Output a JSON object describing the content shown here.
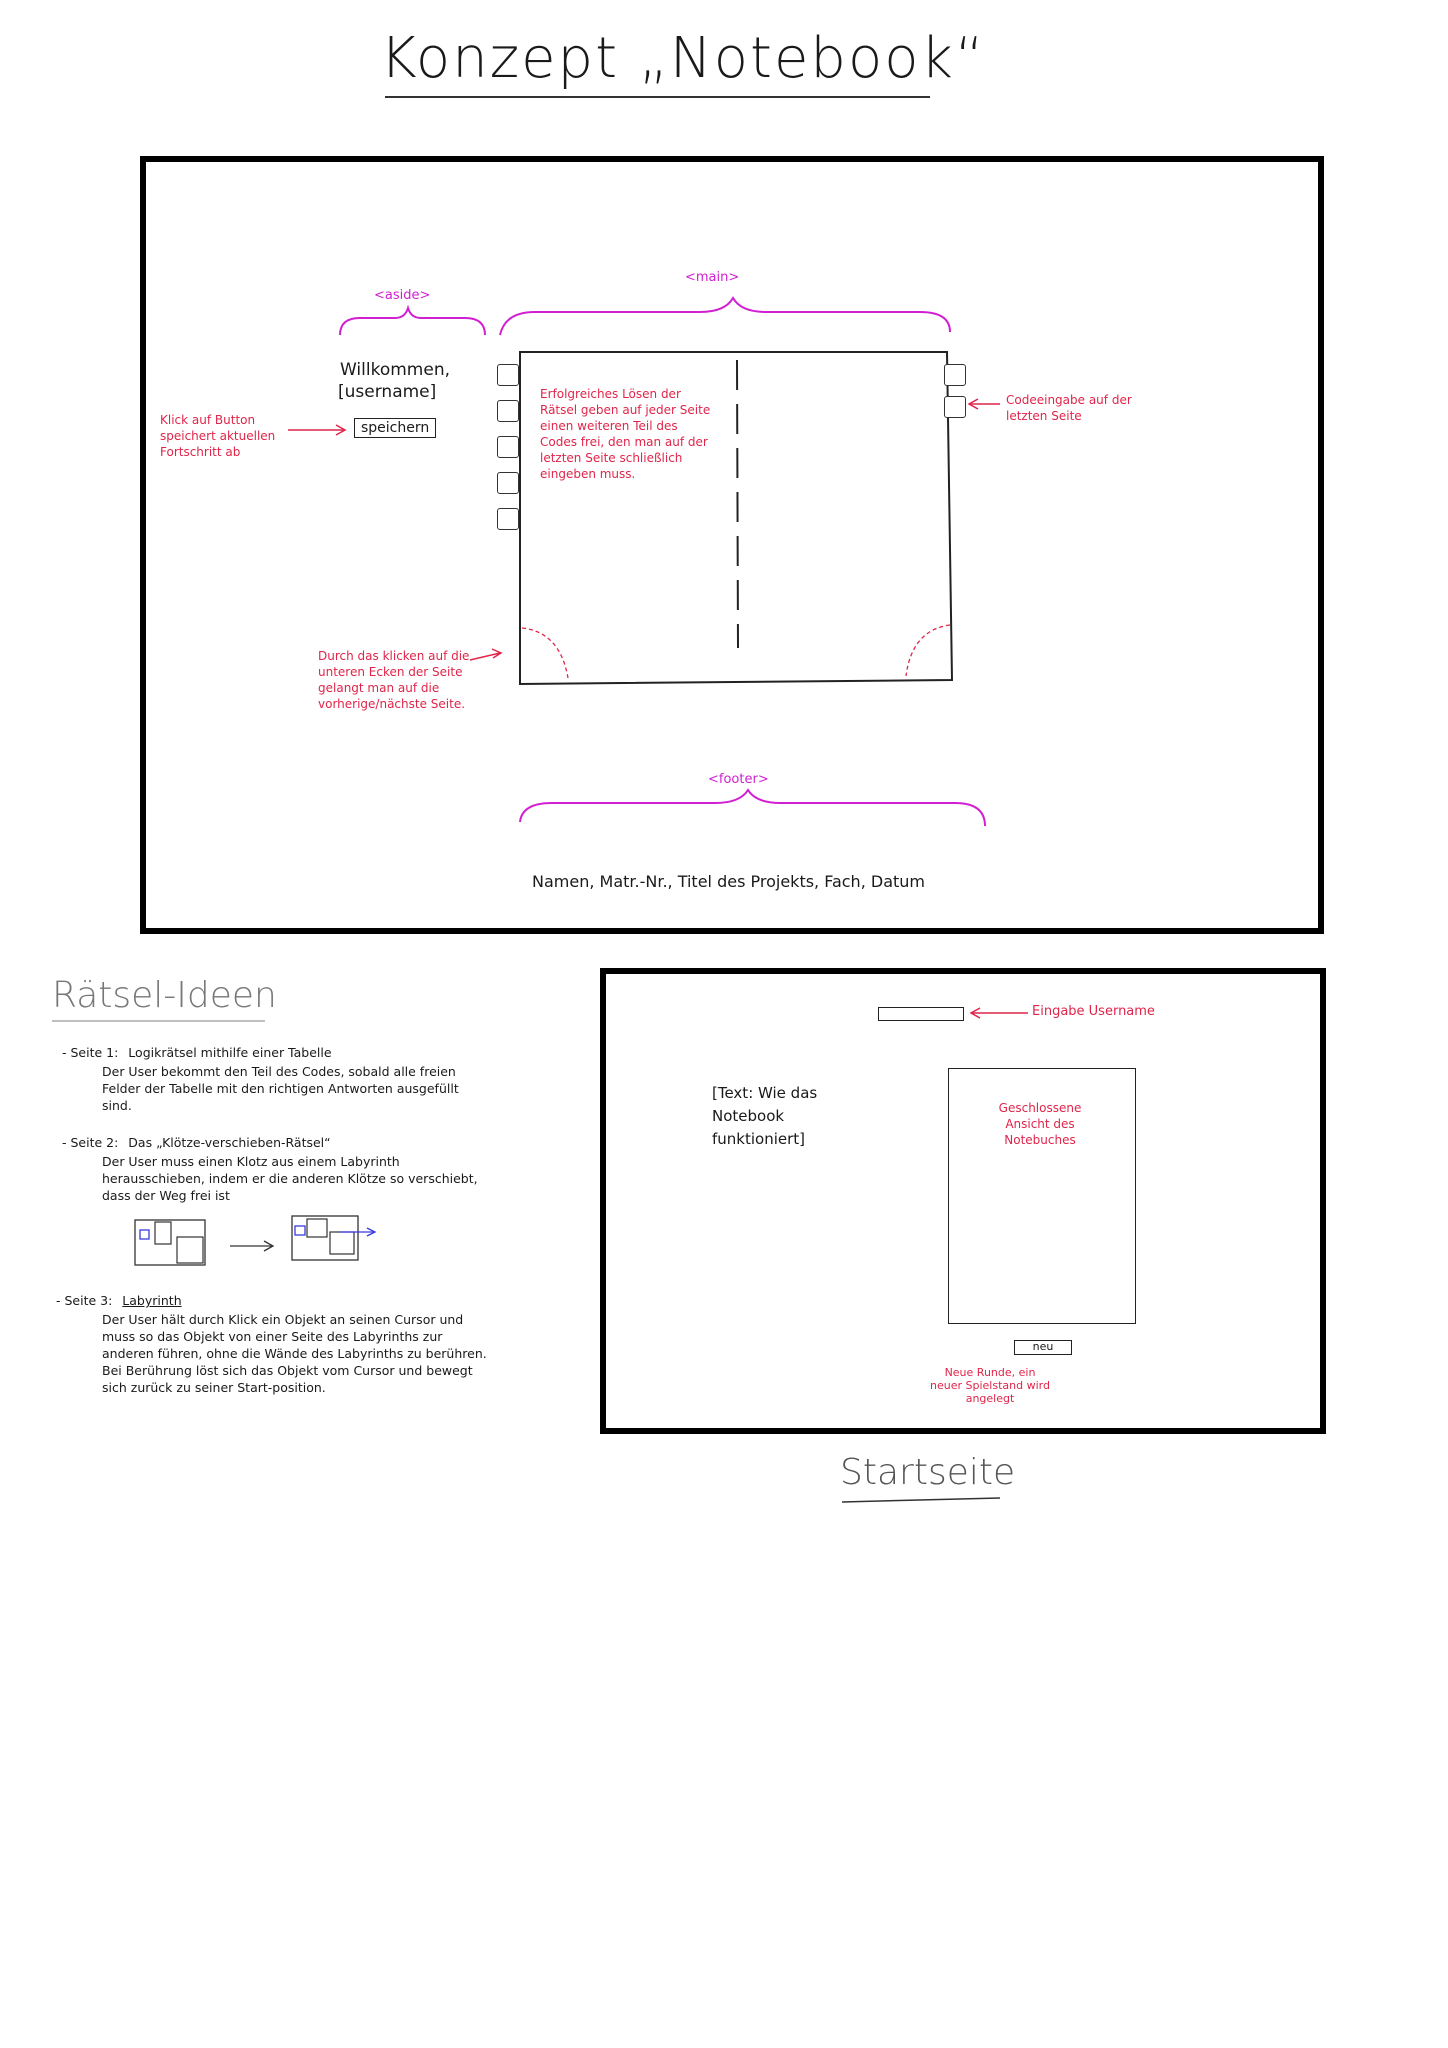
{
  "title": "Konzept „Notebook“",
  "main_sketch": {
    "label_aside": "<aside>",
    "label_main": "<main>",
    "label_footer": "<footer>",
    "welcome": "Willkommen,",
    "username": "[username]",
    "save_button": "speichern",
    "note_save": "Klick auf Button speichert aktuellen Fortschritt ab",
    "note_puzzles": "Erfolgreiches Lösen der Rätsel geben auf jeder Seite einen weiteren Teil des Codes frei, den man auf der letzten Seite schließlich eingeben muss.",
    "note_code": "Codeeingabe auf der letzten Seite",
    "note_corners": "Durch das klicken auf die unteren Ecken der Seite gelangt man auf die vorherige/nächste Seite.",
    "footer_text": "Namen, Matr.-Nr., Titel des Projekts, Fach, Datum"
  },
  "ideas": {
    "heading": "Rätsel-Ideen",
    "items": [
      {
        "label": "- Seite 1:",
        "title": "Logikrätsel mithilfe einer Tabelle",
        "text": "Der User bekommt den Teil des Codes, sobald alle freien Felder der Tabelle mit den richtigen Antworten ausgefüllt sind."
      },
      {
        "label": "- Seite 2:",
        "title": "Das „Klötze-verschieben-Rätsel“",
        "text": "Der User muss einen Klotz aus einem Labyrinth herausschieben, indem er die anderen Klötze so verschiebt, dass der Weg frei ist"
      },
      {
        "label": "- Seite 3:",
        "title": "Labyrinth",
        "text": "Der User hält durch Klick ein Objekt an seinen Cursor und muss so das Objekt von einer Seite des Labyrinths zur anderen führen, ohne die Wände des Labyrinths zu berühren. Bei Berührung löst sich das Objekt vom Cursor und bewegt sich zurück zu seiner Start-position."
      }
    ]
  },
  "start_sketch": {
    "note_input": "Eingabe Username",
    "text": "[Text: Wie das Notebook funktioniert]",
    "closed_view": "Geschlossene Ansicht des Notebuches",
    "new_button": "neu",
    "note_new": "Neue Runde, ein neuer Spielstand wird angelegt",
    "caption": "Startseite"
  },
  "colors": {
    "magenta": "#d21fd2",
    "red": "#e0254a",
    "ink": "#1a1a1a"
  }
}
